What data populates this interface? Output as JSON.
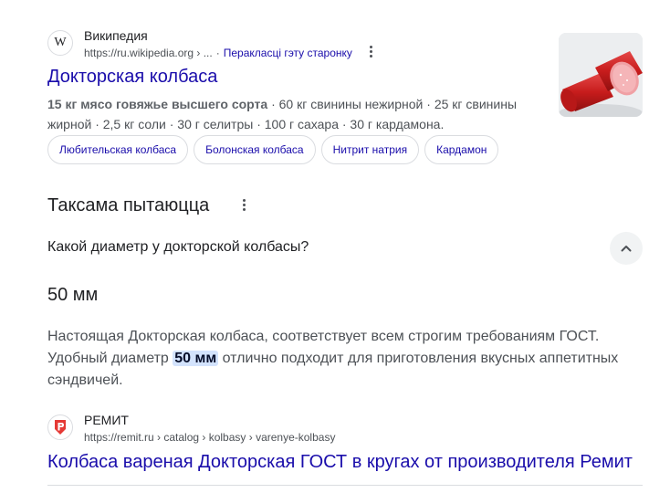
{
  "result1": {
    "site_name": "Википедия",
    "url": "https://ru.wikipedia.org › ...",
    "translate_link": "Перакласці гэту старонку",
    "title": "Докторская колбаса",
    "snippet_bold": "15 кг мясо говяжье высшего сорта",
    "snippet_rest": " · 60 кг свинины нежирной · 25 кг свинины жирной · 2,5 кг соли · 30 г селитры · 100 г сахара · 30 г кардамона.",
    "chips": [
      "Любительская колбаса",
      "Болонская колбаса",
      "Нитрит натрия",
      "Кардамон"
    ]
  },
  "paa": {
    "title": "Таксама пытаюцца",
    "question": "Какой диаметр у докторской колбасы?",
    "answer_headline": "50 мм",
    "answer_before": "Настоящая Докторская колбаса, соответствует всем строгим требованиям ГОСТ. Удобный диаметр ",
    "answer_highlight": "50 мм",
    "answer_after": " отлично подходит для приготовления вкусных аппетитных сэндвичей."
  },
  "result2": {
    "site_name": "РЕМИТ",
    "url": "https://remit.ru › catalog › kolbasy › varenye-kolbasy",
    "title": "Колбаса вареная Докторская ГОСТ в кругах от производителя Ремит"
  },
  "icons": {
    "wiki_favicon": "W",
    "remit_favicon": "remit-logo-icon",
    "more": "more-vert-icon",
    "collapse": "chevron-up-icon"
  },
  "colors": {
    "link": "#1a0dab",
    "text": "#202124",
    "secondary": "#4d5156",
    "highlight": "#d3e3fd"
  }
}
